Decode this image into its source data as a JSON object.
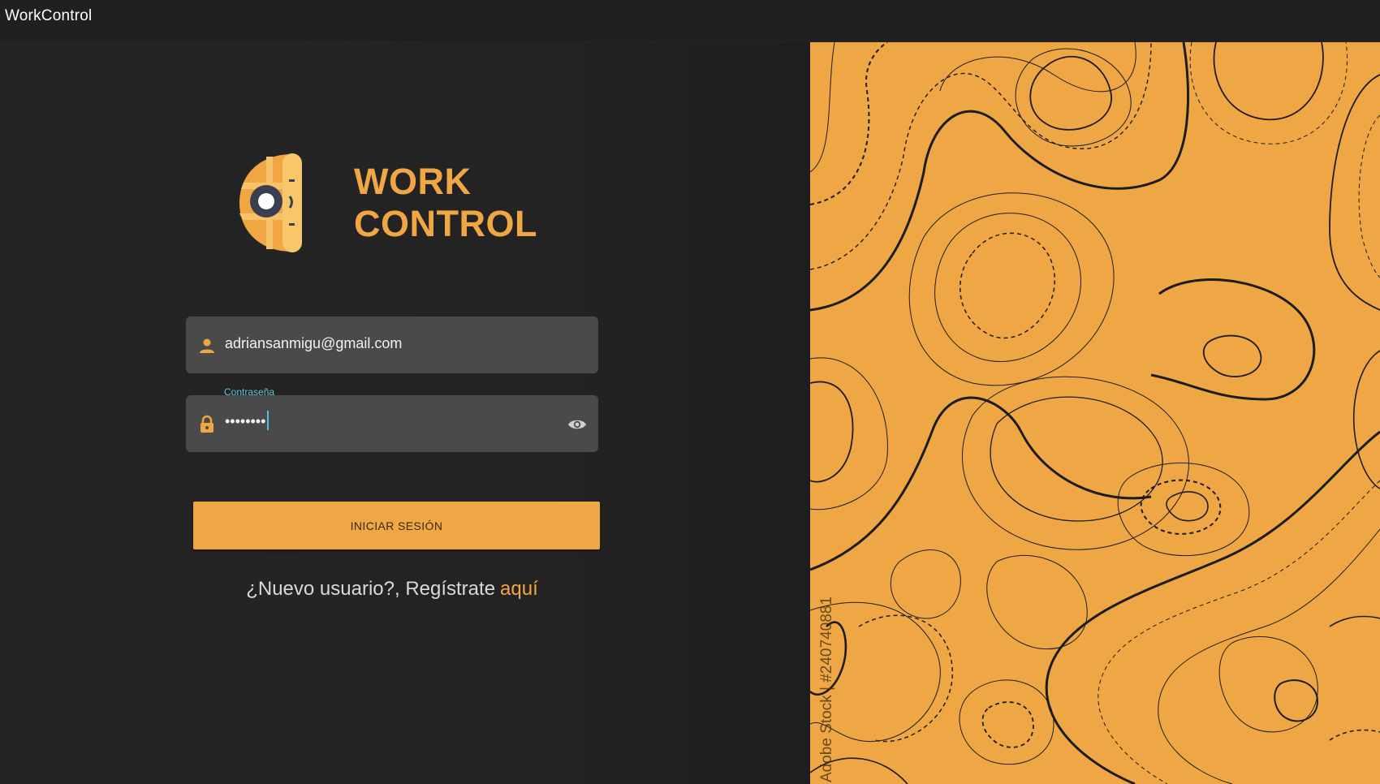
{
  "window": {
    "title": "WorkControl"
  },
  "brand": {
    "line1": "WORK",
    "line2": "CONTROL",
    "color": "#f0a743"
  },
  "form": {
    "email": {
      "value": "adriansanmigu@gmail.com",
      "icon": "person-icon"
    },
    "password": {
      "label": "Contraseña",
      "masked_value": "••••••••",
      "icon": "lock-icon",
      "toggle_icon": "eye-icon"
    },
    "submit_label": "INICIAR SESIÓN",
    "register_text": "¿Nuevo usuario?, Regístrate",
    "register_link": "aquí"
  },
  "image_panel": {
    "watermark": "Adobe Stock | #240740881",
    "accent": "#efa745"
  }
}
